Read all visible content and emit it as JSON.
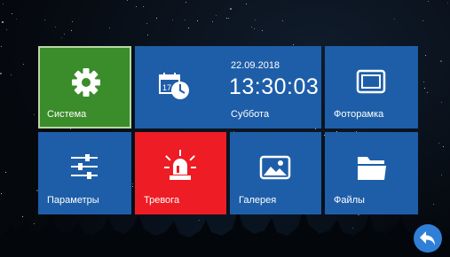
{
  "tiles": {
    "system": {
      "label": "Система",
      "icon": "gear-icon",
      "color": "#3b8c2a"
    },
    "datetime": {
      "date": "22.09.2018",
      "time": "13:30:03",
      "day": "Суббота",
      "icon": "calendar-clock-icon",
      "color": "#1e5ea8"
    },
    "photoframe": {
      "label": "Фоторамка",
      "icon": "photo-frame-icon",
      "color": "#1e5ea8"
    },
    "settings": {
      "label": "Параметры",
      "icon": "sliders-icon",
      "color": "#1e5ea8"
    },
    "alarm": {
      "label": "Тревога",
      "icon": "siren-icon",
      "color": "#ee1c24"
    },
    "gallery": {
      "label": "Галерея",
      "icon": "image-icon",
      "color": "#1e5ea8"
    },
    "files": {
      "label": "Файлы",
      "icon": "folder-icon",
      "color": "#1e5ea8"
    }
  },
  "back_button": {
    "icon": "back-arrow-icon",
    "color": "#2f7fd6"
  }
}
